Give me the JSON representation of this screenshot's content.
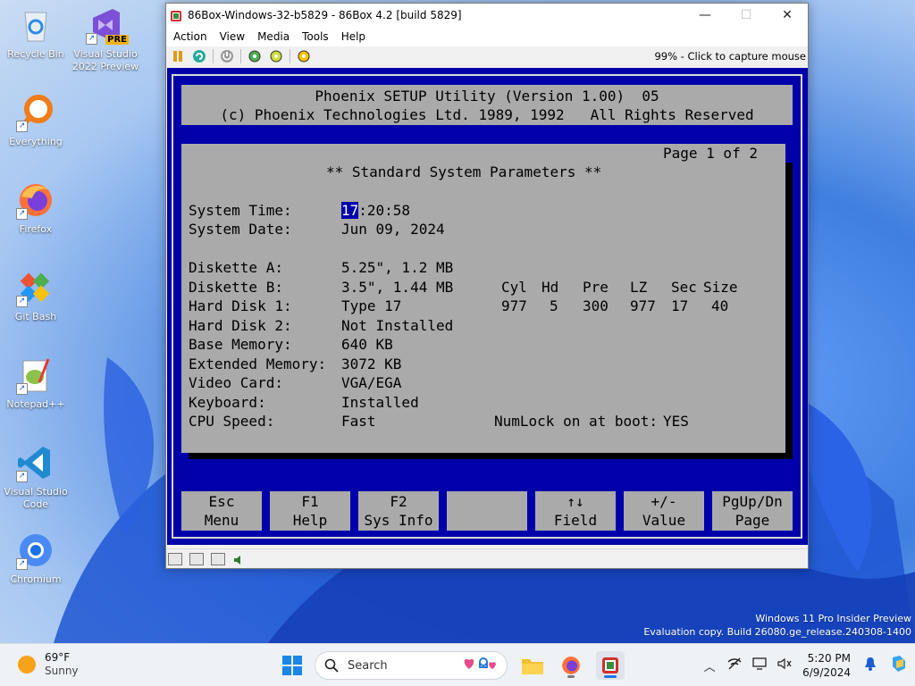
{
  "desktop": {
    "icons": [
      {
        "label": "Recycle Bin"
      },
      {
        "label": "Visual Studio 2022 Preview",
        "badge": "PRE"
      },
      {
        "label": "Everything"
      },
      {
        "label": "Firefox"
      },
      {
        "label": "Git Bash"
      },
      {
        "label": "Notepad++"
      },
      {
        "label": "Visual Studio Code"
      },
      {
        "label": "Chromium"
      }
    ],
    "watermark": {
      "line1": "Windows 11 Pro Insider Preview",
      "line2": "Evaluation copy. Build 26080.ge_release.240308-1400"
    }
  },
  "window": {
    "title": "86Box-Windows-32-b5829 - 86Box 4.2 [build 5829]",
    "controls": {
      "minimize": "—",
      "maximize": "☐",
      "close": "✕"
    },
    "menu": [
      "Action",
      "View",
      "Media",
      "Tools",
      "Help"
    ],
    "toolbar": {
      "icons": [
        "pause-icon",
        "reset-icon",
        "power-icon",
        "settings-icon",
        "settings-2-icon",
        "settings-3-icon"
      ],
      "status": "99% - Click to capture mouse"
    }
  },
  "bios": {
    "header_line1": "Phoenix SETUP Utility (Version 1.00)  05",
    "header_line2": "(c) Phoenix Technologies Ltd. 1989, 1992   All Rights Reserved",
    "page": "Page 1 of 2",
    "title": "** Standard System Parameters **",
    "time_label": "System Time:",
    "time_hour": "17",
    "time_rest": ":20:58",
    "date_label": "System Date:",
    "date_value": "Jun 09, 2024",
    "diskette_a_label": "Diskette A:",
    "diskette_a_value": "5.25\", 1.2 MB",
    "diskette_b_label": "Diskette B:",
    "diskette_b_value": "3.5\", 1.44 MB",
    "hd1_label": "Hard Disk 1:",
    "hd1_value": "Type 17",
    "hd2_label": "Hard Disk 2:",
    "hd2_value": "Not Installed",
    "base_mem_label": "Base Memory:",
    "base_mem_value": "640 KB",
    "ext_mem_label": "Extended Memory:",
    "ext_mem_value": "3072 KB",
    "video_label": "Video Card:",
    "video_value": "VGA/EGA",
    "keyboard_label": "Keyboard:",
    "keyboard_value": "Installed",
    "cpu_label": "CPU Speed:",
    "cpu_value": "Fast",
    "numlock_label": "NumLock on at boot:",
    "numlock_value": "YES",
    "disk_headers": [
      "Cyl",
      "Hd",
      "Pre",
      "LZ",
      "Sec",
      "Size"
    ],
    "disk_values": [
      "977",
      "5",
      "300",
      "977",
      "17",
      "40"
    ],
    "fkeys": [
      {
        "top": "Esc",
        "bottom": "Menu"
      },
      {
        "top": "F1",
        "bottom": "Help"
      },
      {
        "top": "F2",
        "bottom": "Sys Info"
      },
      {
        "top": "",
        "bottom": ""
      },
      {
        "top": "↑↓",
        "bottom": "Field"
      },
      {
        "top": "+/-",
        "bottom": "Value"
      },
      {
        "top": "PgUp/Dn",
        "bottom": "Page"
      }
    ]
  },
  "taskbar": {
    "weather_temp": "69°F",
    "weather_cond": "Sunny",
    "search_placeholder": "Search",
    "time": "5:20 PM",
    "date": "6/9/2024"
  }
}
